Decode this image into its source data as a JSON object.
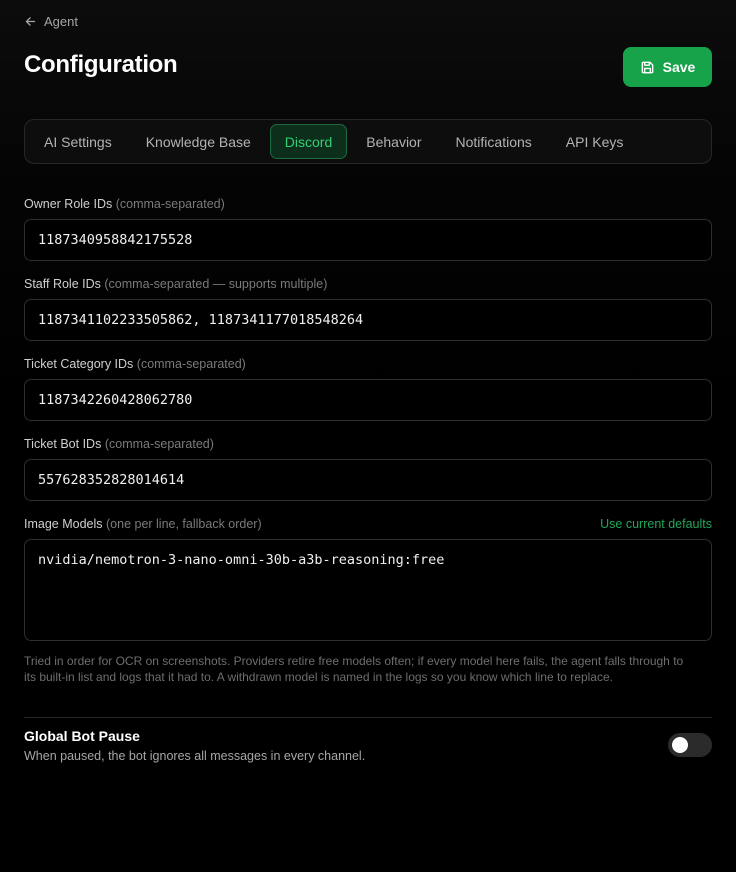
{
  "header": {
    "back_label": "Agent",
    "title": "Configuration",
    "save_label": "Save"
  },
  "tabs": [
    {
      "label": "AI Settings",
      "active": false
    },
    {
      "label": "Knowledge Base",
      "active": false
    },
    {
      "label": "Discord",
      "active": true
    },
    {
      "label": "Behavior",
      "active": false
    },
    {
      "label": "Notifications",
      "active": false
    },
    {
      "label": "API Keys",
      "active": false
    }
  ],
  "fields": {
    "owner_roles": {
      "label": "Owner Role IDs",
      "hint": "(comma-separated)",
      "value": "1187340958842175528"
    },
    "staff_roles": {
      "label": "Staff Role IDs",
      "hint": "(comma-separated — supports multiple)",
      "value": "1187341102233505862, 1187341177018548264"
    },
    "ticket_categories": {
      "label": "Ticket Category IDs",
      "hint": "(comma-separated)",
      "value": "1187342260428062780"
    },
    "ticket_bots": {
      "label": "Ticket Bot IDs",
      "hint": "(comma-separated)",
      "value": "557628352828014614"
    },
    "image_models": {
      "label": "Image Models",
      "hint": "(one per line, fallback order)",
      "defaults_link": "Use current defaults",
      "value": "nvidia/nemotron-3-nano-omni-30b-a3b-reasoning:free",
      "help": "Tried in order for OCR on screenshots. Providers retire free models often; if every model here fails, the agent falls through to its built-in list and logs that it had to. A withdrawn model is named in the logs so you know which line to replace."
    }
  },
  "global_pause": {
    "title": "Global Bot Pause",
    "description": "When paused, the bot ignores all messages in every channel.",
    "enabled": false
  },
  "colors": {
    "accent": "#16a34a",
    "accent_text": "#34d077",
    "background": "#000000"
  }
}
